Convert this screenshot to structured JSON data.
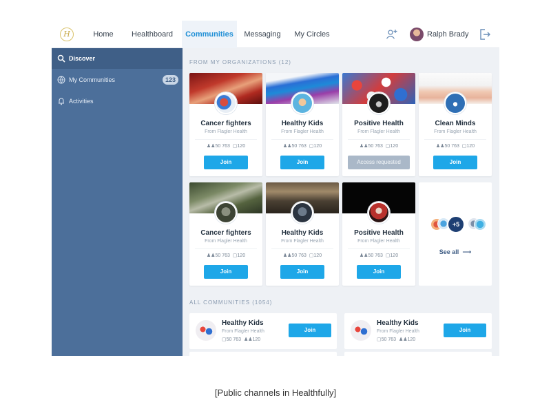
{
  "nav": {
    "logo_glyph": "H",
    "items": [
      {
        "label": "Home",
        "active": false
      },
      {
        "label": "Healthboard",
        "active": false
      },
      {
        "label": "Communities",
        "active": true
      },
      {
        "label": "Messaging",
        "active": false
      },
      {
        "label": "My Circles",
        "active": false
      }
    ],
    "user_name": "Ralph Brady"
  },
  "sidebar": {
    "items": [
      {
        "label": "Discover",
        "icon": "search-icon",
        "active": true
      },
      {
        "label": "My Communities",
        "icon": "globe-icon",
        "count": "123"
      },
      {
        "label": "Activities",
        "icon": "bell-icon"
      }
    ]
  },
  "main": {
    "org_section_label": "FROM MY ORGANIZATIONS (12)",
    "org_cards": [
      {
        "title": "Cancer fighters",
        "org": "From Flagler Health",
        "members": "50 763",
        "posts": "120",
        "button": "Join",
        "state": "join"
      },
      {
        "title": "Healthy Kids",
        "org": "From Flagler Health",
        "members": "50 763",
        "posts": "120",
        "button": "Join",
        "state": "join"
      },
      {
        "title": "Positive Health",
        "org": "From Flagler Health",
        "members": "50 763",
        "posts": "120",
        "button": "Access requested",
        "state": "requested"
      },
      {
        "title": "Clean Minds",
        "org": "From Flagler Health",
        "members": "50 763",
        "posts": "120",
        "button": "Join",
        "state": "join"
      },
      {
        "title": "Cancer fighters",
        "org": "From Flagler Health",
        "members": "50 763",
        "posts": "120",
        "button": "Join",
        "state": "join"
      },
      {
        "title": "Healthy Kids",
        "org": "From Flagler Health",
        "members": "50 763",
        "posts": "120",
        "button": "Join",
        "state": "join"
      },
      {
        "title": "Positive Health",
        "org": "From Flagler Health",
        "members": "50 763",
        "posts": "120",
        "button": "Join",
        "state": "join"
      }
    ],
    "see_all": {
      "count_badge": "+5",
      "label": "See all"
    },
    "all_section_label": "ALL COMMUNITIES (1054)",
    "all_list": [
      {
        "title": "Healthy Kids",
        "org": "From Flagler Health",
        "members": "50 763",
        "posts": "120",
        "button": "Join"
      },
      {
        "title": "Healthy Kids",
        "org": "From Flagler Health",
        "members": "50 763",
        "posts": "120",
        "button": "Join"
      }
    ]
  },
  "caption": "[Public channels in Healthfully]",
  "colors": {
    "accent": "#1ea7e8",
    "sidebar": "#4c6f9a",
    "sidebar_active": "#3f5f87",
    "disabled_button": "#aab8c8"
  }
}
